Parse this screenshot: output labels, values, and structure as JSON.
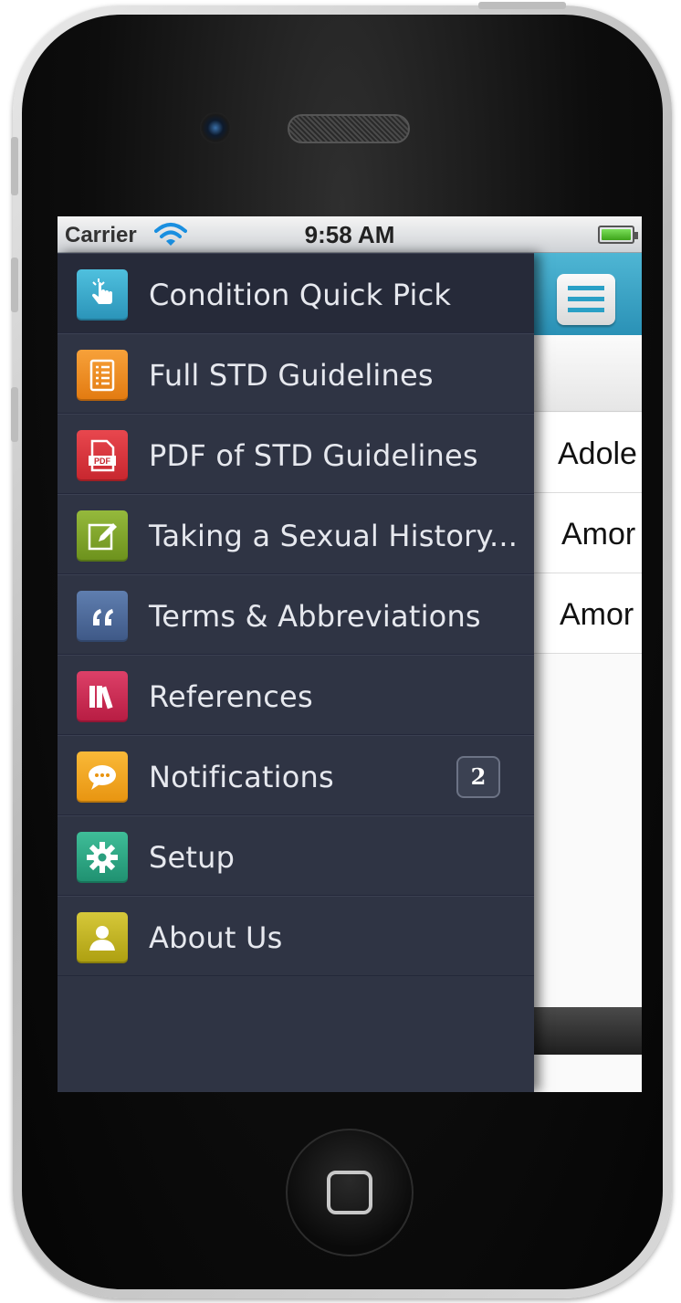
{
  "status_bar": {
    "carrier": "Carrier",
    "time": "9:58 AM"
  },
  "background_content": {
    "rows": [
      "Adole",
      "Amor",
      "Amor"
    ]
  },
  "menu": {
    "items": [
      {
        "label": "Condition Quick Pick",
        "icon": "tap-hand-icon",
        "color": "#3aa9cc",
        "selected": true
      },
      {
        "label": "Full STD Guidelines",
        "icon": "list-document-icon",
        "color": "#f08a1c"
      },
      {
        "label": "PDF of STD Guidelines",
        "icon": "pdf-icon",
        "color": "#d8343c"
      },
      {
        "label": "Taking a Sexual History...",
        "icon": "edit-pencil-icon",
        "color": "#7fa32a"
      },
      {
        "label": "Terms & Abbreviations",
        "icon": "quote-icon",
        "color": "#4d6a9a"
      },
      {
        "label": "References",
        "icon": "books-icon",
        "color": "#cc2a52"
      },
      {
        "label": "Notifications",
        "icon": "speech-bubble-icon",
        "color": "#f4a81c",
        "badge": "2"
      },
      {
        "label": "Setup",
        "icon": "gear-icon",
        "color": "#2ea582"
      },
      {
        "label": "About Us",
        "icon": "user-icon",
        "color": "#c5b61a"
      }
    ]
  }
}
